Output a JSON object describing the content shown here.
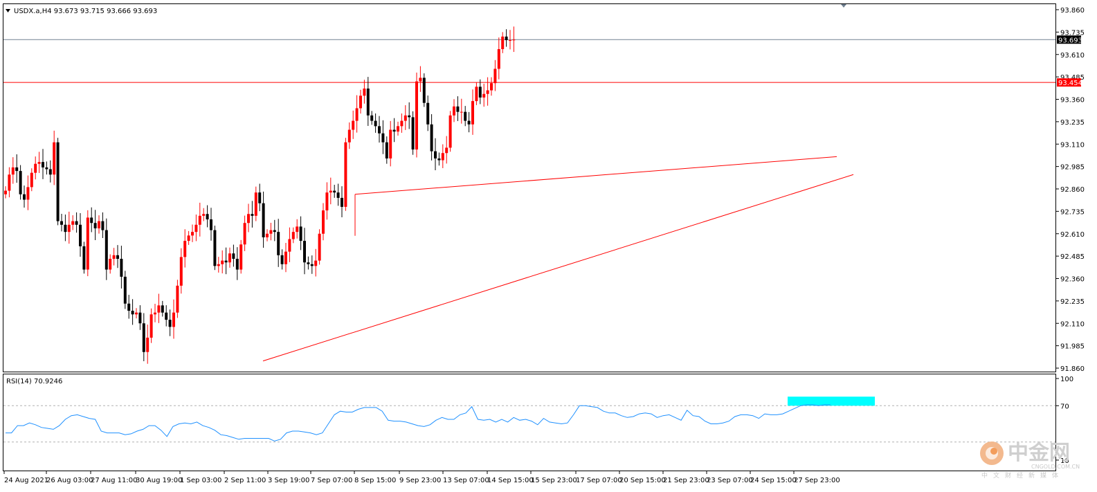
{
  "header": {
    "symbol_line": "USDX.a,H4  93.673 93.715 93.666 93.693",
    "rsi_label": "RSI(14) 70.9246"
  },
  "watermark": {
    "brand": "中金网",
    "site": "CNGOLD.COM.CN",
    "tagline": "中文财经新媒体"
  },
  "colors": {
    "bull": "#ff0000",
    "bear": "#000000",
    "trendline": "#ff0000",
    "rsi_line": "#1e90ff",
    "rsi_highlight": "#00ffff",
    "price_line": "#708090",
    "level_line": "#ff0000",
    "frame": "#000000"
  },
  "chart_data": {
    "type": "candlestick",
    "symbol": "USDX.a",
    "timeframe": "H4",
    "last_bar": {
      "open": 93.673,
      "high": 93.715,
      "low": 93.666,
      "close": 93.693
    },
    "ylim": [
      91.86,
      93.86
    ],
    "y_ticks": [
      "93.860",
      "93.735",
      "93.610",
      "93.485",
      "93.360",
      "93.235",
      "93.110",
      "92.985",
      "92.860",
      "92.735",
      "92.610",
      "92.485",
      "92.360",
      "92.235",
      "92.110",
      "91.985",
      "91.860"
    ],
    "x_ticks": [
      "24 Aug 2021",
      "26 Aug 03:00",
      "27 Aug 11:00",
      "30 Aug 19:00",
      "1 Sep 03:00",
      "2 Sep 11:00",
      "3 Sep 19:00",
      "7 Sep 07:00",
      "8 Sep 15:00",
      "9 Sep 23:00",
      "13 Sep 07:00",
      "14 Sep 15:00",
      "15 Sep 23:00",
      "17 Sep 07:00",
      "20 Sep 15:00",
      "21 Sep 23:00",
      "23 Sep 07:00",
      "24 Sep 15:00",
      "27 Sep 23:00"
    ],
    "current_price": {
      "value": 93.693,
      "label": "93.693"
    },
    "horizontal_level": {
      "value": 93.454,
      "label": "93.454"
    },
    "trendlines": [
      {
        "from": {
          "bar": 0,
          "price": 91.9
        },
        "to": {
          "bar": 0,
          "price": 92.94
        },
        "note": "lower"
      },
      {
        "from": {
          "bar": 0,
          "price": 92.83
        },
        "to": {
          "bar": 0,
          "price": 93.04
        },
        "note": "upper"
      }
    ],
    "closes": [
      92.85,
      92.94,
      92.98,
      92.96,
      92.83,
      92.8,
      92.87,
      92.95,
      93.0,
      93.01,
      92.98,
      92.97,
      92.94,
      93.12,
      92.68,
      92.66,
      92.62,
      92.66,
      92.68,
      92.66,
      92.54,
      92.41,
      92.7,
      92.67,
      92.64,
      92.68,
      92.63,
      92.41,
      92.47,
      92.49,
      92.47,
      92.37,
      92.22,
      92.18,
      92.16,
      92.17,
      92.11,
      91.95,
      92.03,
      92.16,
      92.17,
      92.21,
      92.17,
      92.13,
      92.09,
      92.17,
      92.32,
      92.48,
      92.57,
      92.6,
      92.62,
      92.66,
      92.71,
      92.72,
      92.69,
      92.63,
      92.43,
      92.44,
      92.46,
      92.45,
      92.5,
      92.47,
      92.41,
      92.55,
      92.67,
      92.72,
      92.71,
      92.84,
      92.78,
      92.59,
      92.61,
      92.63,
      92.62,
      92.49,
      92.44,
      92.51,
      92.58,
      92.62,
      92.65,
      92.57,
      92.45,
      92.44,
      92.43,
      92.46,
      92.61,
      92.74,
      92.84,
      92.85,
      92.84,
      92.81,
      92.76,
      93.12,
      93.19,
      93.24,
      93.31,
      93.38,
      93.42,
      93.27,
      93.24,
      93.21,
      93.17,
      93.12,
      93.03,
      93.19,
      93.18,
      93.21,
      93.24,
      93.27,
      93.26,
      93.08,
      93.46,
      93.48,
      93.34,
      93.22,
      93.07,
      93.03,
      93.02,
      93.06,
      93.09,
      93.27,
      93.32,
      93.29,
      93.29,
      93.24,
      93.22,
      93.35,
      93.43,
      93.37,
      93.39,
      93.41,
      93.45,
      93.53,
      93.64,
      93.71,
      93.69,
      93.69,
      93.693
    ],
    "rsi": {
      "name": "RSI(14)",
      "value": 70.9246,
      "ylim": [
        0,
        100
      ],
      "levels": [
        70,
        30
      ],
      "y_ticks": [
        "100",
        "70",
        "10"
      ],
      "highlight_range": [
        70,
        80
      ],
      "values": [
        40,
        40,
        48,
        48,
        51,
        49,
        46,
        45,
        44,
        48,
        55,
        59,
        60,
        58,
        56,
        55,
        42,
        40,
        40,
        40,
        38,
        39,
        42,
        44,
        48,
        48,
        43,
        36,
        47,
        50,
        51,
        50,
        52,
        48,
        46,
        43,
        38,
        37,
        35,
        33,
        34,
        34,
        34,
        34,
        34,
        31,
        33,
        40,
        42,
        42,
        41,
        40,
        38,
        40,
        50,
        60,
        64,
        63,
        63,
        66,
        68,
        68,
        68,
        64,
        54,
        53,
        53,
        52,
        50,
        48,
        47,
        49,
        54,
        57,
        55,
        55,
        60,
        62,
        69,
        55,
        54,
        55,
        52,
        55,
        52,
        57,
        54,
        55,
        53,
        49,
        56,
        52,
        51,
        50,
        51,
        60,
        70,
        70,
        69,
        68,
        64,
        62,
        62,
        59,
        57,
        58,
        61,
        62,
        61,
        57,
        59,
        60,
        57,
        54,
        65,
        59,
        58,
        53,
        50,
        50,
        51,
        53,
        58,
        60,
        60,
        59,
        56,
        61,
        60,
        60,
        61,
        64,
        67,
        70,
        71,
        71,
        70,
        71,
        70.9246
      ]
    }
  }
}
